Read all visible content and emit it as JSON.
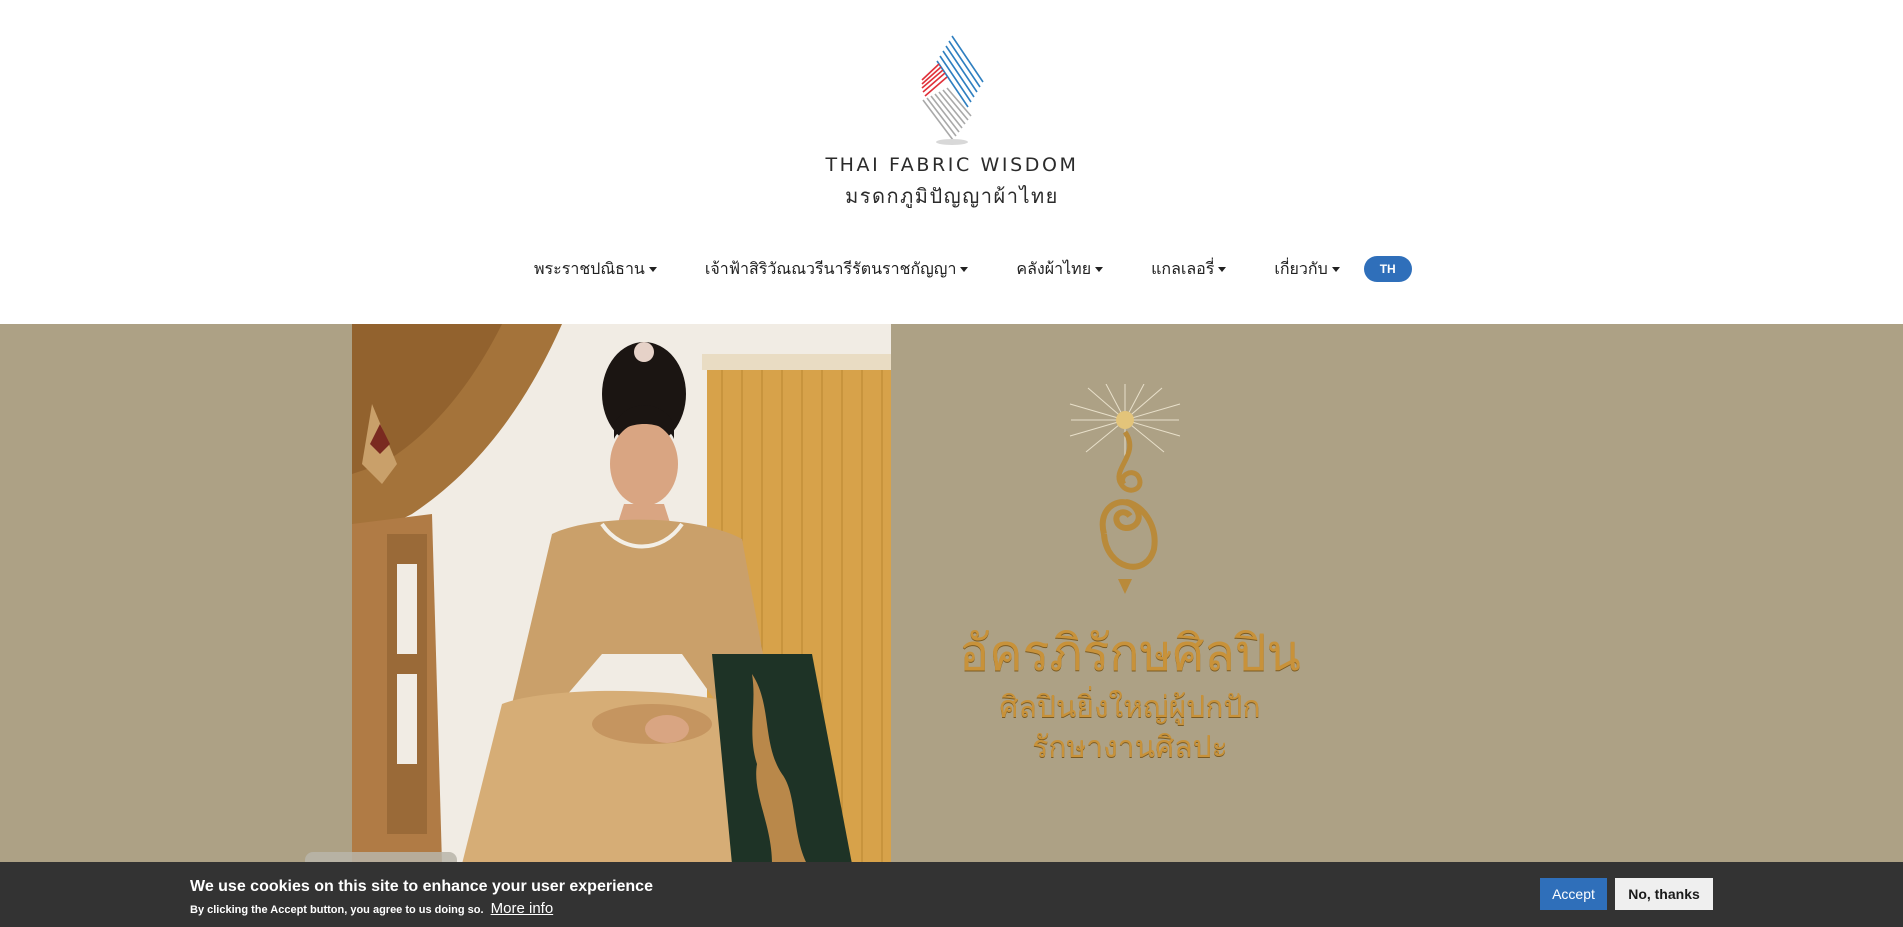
{
  "logo": {
    "name_en": "THAI FABRIC WISDOM",
    "name_th": "มรดกภูมิปัญญาผ้าไทย"
  },
  "nav": {
    "items": [
      {
        "label": "พระราชปณิธาน"
      },
      {
        "label": "เจ้าฟ้าสิริวัณณวรีนารีรัตนราชกัญญา"
      },
      {
        "label": "คลังผ้าไทย"
      },
      {
        "label": "แกลเลอรี่"
      },
      {
        "label": "เกี่ยวกับ"
      }
    ],
    "language": "TH"
  },
  "hero": {
    "title": "อัครภิรักษศิลปิน",
    "subtitle_line1": "ศิลปินยิ่งใหญ่ผู้ปกปัก",
    "subtitle_line2": "รักษางานศิลปะ"
  },
  "cookie_banner": {
    "title": "We use cookies on this site to enhance your user experience",
    "description": "By clicking the Accept button, you agree to us doing so.",
    "more_info": "More info",
    "accept": "Accept",
    "decline": "No, thanks"
  },
  "colors": {
    "hero_background": "#ada185",
    "accent_blue": "#2f6fba",
    "cookie_background": "#333333",
    "gold_text": "#c8923a"
  }
}
